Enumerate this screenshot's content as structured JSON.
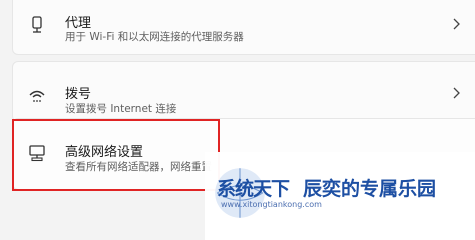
{
  "settings": {
    "items": [
      {
        "title": "代理",
        "description": "用于 Wi-Fi 和以太网连接的代理服务器",
        "icon": "proxy-icon"
      },
      {
        "title": "拨号",
        "description": "设置拨号 Internet 连接",
        "icon": "dialup-icon"
      },
      {
        "title": "高级网络设置",
        "description": "查看所有网络适配器，网络重置",
        "icon": "advanced-network-icon"
      }
    ],
    "highlight_color": "#e02424"
  },
  "watermark": {
    "logo_text": "系统天下",
    "slogan": "辰奕的专属乐园",
    "url": "www.xitongtiankong.com",
    "color": "#1d4fa3"
  }
}
